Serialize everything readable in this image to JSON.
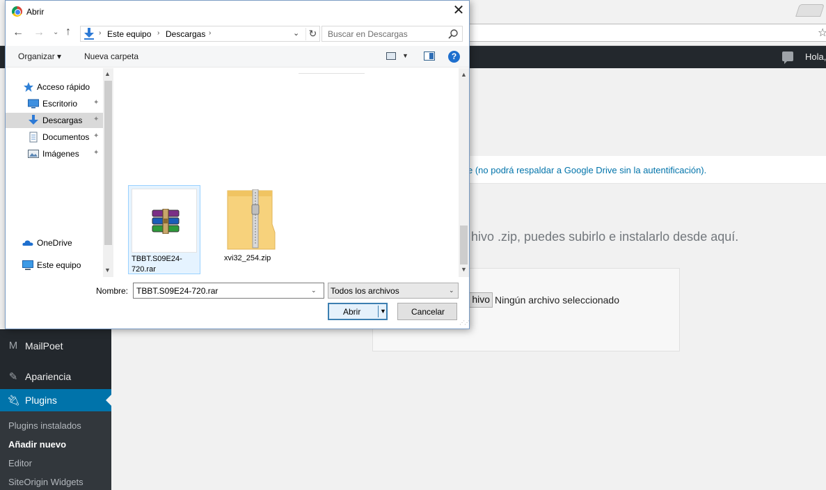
{
  "dialog": {
    "title": "Abrir",
    "close_glyph": "✕",
    "nav": {
      "back_glyph": "←",
      "forward_glyph": "→",
      "recent_glyph": "⌄",
      "up_glyph": "↑",
      "path": [
        "Este equipo",
        "Descargas"
      ],
      "separator": "›",
      "dropdown_glyph": "⌄",
      "refresh_glyph": "↻",
      "search_placeholder": "Buscar en Descargas"
    },
    "toolbar": {
      "organize": "Organizar ▾",
      "new_folder": "Nueva carpeta",
      "view_arrow": "▼",
      "help": "?"
    },
    "nav_pane": {
      "items": [
        {
          "label": "Acceso rápido",
          "icon": "star-icon"
        },
        {
          "label": "Escritorio",
          "icon": "desktop-icon",
          "pinned": true
        },
        {
          "label": "Descargas",
          "icon": "downloads-icon",
          "pinned": true,
          "selected": true
        },
        {
          "label": "Documentos",
          "icon": "documents-icon",
          "pinned": true
        },
        {
          "label": "Imágenes",
          "icon": "pictures-icon",
          "pinned": true
        },
        {
          "label": "OneDrive",
          "icon": "cloud-icon"
        },
        {
          "label": "Este equipo",
          "icon": "computer-icon"
        }
      ],
      "pin_glyph": "📌",
      "scroll_up": "▲",
      "scroll_down": "▼"
    },
    "files": [
      {
        "name": "TBBT.S09E24-720.rar",
        "icon": "winrar-archive-icon",
        "selected": true
      },
      {
        "name": "xvi32_254.zip",
        "icon": "zip-folder-icon",
        "selected": false
      }
    ],
    "footer": {
      "name_label": "Nombre:",
      "name_value": "TBBT.S09E24-720.rar",
      "filter_value": "Todos los archivos",
      "open_label": "Abrir",
      "cancel_label": "Cancelar",
      "dropdown_glyph": "▼",
      "grip_glyph": "⋰⋰"
    }
  },
  "background": {
    "adminbar_greeting": "Hola,",
    "notice_text": "e (no podrá respaldar a Google Drive sin la autentificación).",
    "upload_help": "hivo .zip, puedes subirlo e instalarlo desde aquí.",
    "file_button": "hivo",
    "file_status": "Ningún archivo seleccionado",
    "menu": {
      "mailpoet": "MailPoet",
      "apariencia": "Apariencia",
      "plugins": "Plugins"
    },
    "submenu": [
      {
        "label": "Plugins instalados",
        "current": false
      },
      {
        "label": "Añadir nuevo",
        "current": true
      },
      {
        "label": "Editor",
        "current": false
      },
      {
        "label": "SiteOrigin Widgets",
        "current": false
      }
    ]
  },
  "colors": {
    "wp_dark": "#23282d",
    "wp_accent": "#0073aa",
    "dialog_selection": "#e5f3ff"
  }
}
